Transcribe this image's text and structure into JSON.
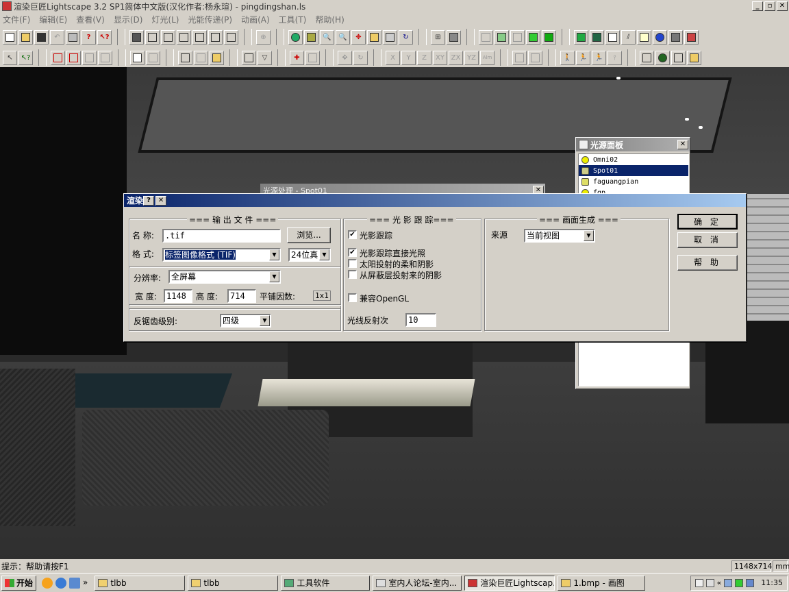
{
  "window": {
    "title": "渲染巨匠Lightscape 3.2 SP1简体中文版(汉化作者:杨永瑄) - pingdingshan.ls",
    "minimize": "_",
    "restore": "▫",
    "close": "✕"
  },
  "menu": [
    "文件(F)",
    "编辑(E)",
    "查看(V)",
    "显示(D)",
    "灯光(L)",
    "光能传递(P)",
    "动画(A)",
    "工具(T)",
    "帮助(H)"
  ],
  "toolbar2_axis": [
    "X",
    "Y",
    "Z",
    "XY",
    "ZX",
    "YZ",
    "Alm"
  ],
  "behind_window": {
    "title": "光源处理 - Spot01",
    "close": "✕"
  },
  "light_panel": {
    "title": "光源面板",
    "close": "✕",
    "items": [
      "Omni02",
      "Spot01",
      "faguangpian",
      "fgp"
    ],
    "selected_index": 1
  },
  "dialog": {
    "title": "渲染",
    "help_icon": "?",
    "close_icon": "✕",
    "output": {
      "group_label": "=== 输 出 文 件 ===",
      "name_label": "名 称:",
      "name_value": ".tif",
      "browse": "浏览...",
      "format_label": "格 式:",
      "format_value": "标签图像格式 (TIF)",
      "bits_value": "24位真",
      "resolution_label": "分辨率:",
      "resolution_value": "全屏幕",
      "width_label": "宽 度:",
      "width_value": "1148",
      "height_label": "高 度:",
      "height_value": "714",
      "tile_label": "平铺因数:",
      "tile_value": "1x1",
      "aa_label": "反锯齿级别:",
      "aa_value": "四级"
    },
    "raytrace": {
      "group_label": "=== 光 影 跟 踪===",
      "opt1": "光影跟踪",
      "opt2": "光影跟踪直接光照",
      "opt3": "太阳投射的柔和阴影",
      "opt4": "从屏蔽层投射来的阴影",
      "opt5": "兼容OpenGL",
      "bounce_label": "光线反射次",
      "bounce_value": "10",
      "checks": [
        true,
        true,
        false,
        false,
        false
      ]
    },
    "frame": {
      "group_label": "=== 画面生成 ===",
      "source_label": "来源",
      "source_value": "当前视图"
    },
    "buttons": {
      "ok": "确 定",
      "cancel": "取 消",
      "help": "帮 助"
    }
  },
  "status": {
    "hint": "提示：帮助请按F1",
    "size": "1148x714",
    "unit": "mm"
  },
  "taskbar": {
    "start": "开始",
    "chevron": "»",
    "tasks": [
      "tlbb",
      "tlbb",
      "工具软件",
      "室内人论坛-室内...",
      "渲染巨匠Lightscap...",
      "1.bmp - 画图"
    ],
    "active_index": 4,
    "time": "11:35",
    "tray_chevron": "«"
  },
  "colors": {
    "titlebar_active": "#0a246a",
    "selection": "#0a246a",
    "face": "#d4d0c8"
  }
}
